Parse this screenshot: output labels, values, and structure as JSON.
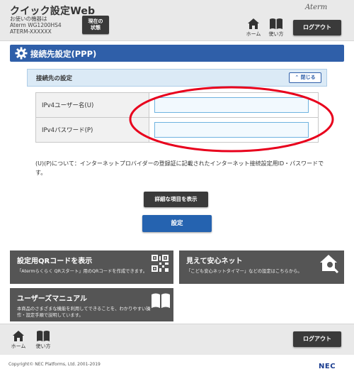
{
  "header": {
    "title": "クイック設定Web",
    "device_line1": "お使いの機器は",
    "device_line2": "Aterm WG1200HS4",
    "device_line3": "ATERM-XXXXXX",
    "status_btn_line1": "現在の",
    "status_btn_line2": "状態",
    "brand": "Aterm",
    "home_label": "ホーム",
    "usage_label": "使い方",
    "logout_label": "ログアウト"
  },
  "page": {
    "title": "接続先設定(PPP)"
  },
  "section": {
    "title": "接続先の設定",
    "collapse_label": "閉じる",
    "rows": [
      {
        "label": "IPv4ユーザー名(U)",
        "value": ""
      },
      {
        "label": "IPv4パスワード(P)",
        "value": ""
      }
    ],
    "note": "(U)(P)について：インターネットプロバイダーの登録証に記載されたインターネット接続設定用ID・パスワードです。"
  },
  "buttons": {
    "detail": "詳細な項目を表示",
    "apply": "設定"
  },
  "cards": {
    "qr": {
      "title": "設定用QRコードを表示",
      "desc": "「Atermらくらく QRスタート」用のQRコードを作成できます。"
    },
    "safety": {
      "title": "見えて安心ネット",
      "desc": "「こども安心ネットタイマー」などの設定はこちらから。"
    },
    "manual": {
      "title": "ユーザーズマニュアル",
      "desc_line1": "本商品のさまざまな機能を利用してできることを、わかりやすい操",
      "desc_line2": "作・設定手順で説明しています。"
    }
  },
  "footer": {
    "home_label": "ホーム",
    "usage_label": "使い方",
    "logout_label": "ログアウト",
    "copyright": "Copyright© NEC Platforms, Ltd. 2001-2019",
    "logo": "NEC"
  },
  "colors": {
    "accent": "#2f5fa9",
    "apply": "#2563b0",
    "annotation": "#e8001c",
    "dark_button": "#3a3a3a",
    "card_bg": "#555555"
  },
  "icons": {
    "settings": "gear-icon",
    "home": "home-icon",
    "usage": "book-icon",
    "collapse": "chevron-up-icon",
    "qr": "qr-code-icon",
    "safety": "house-search-icon",
    "manual": "open-book-icon"
  }
}
